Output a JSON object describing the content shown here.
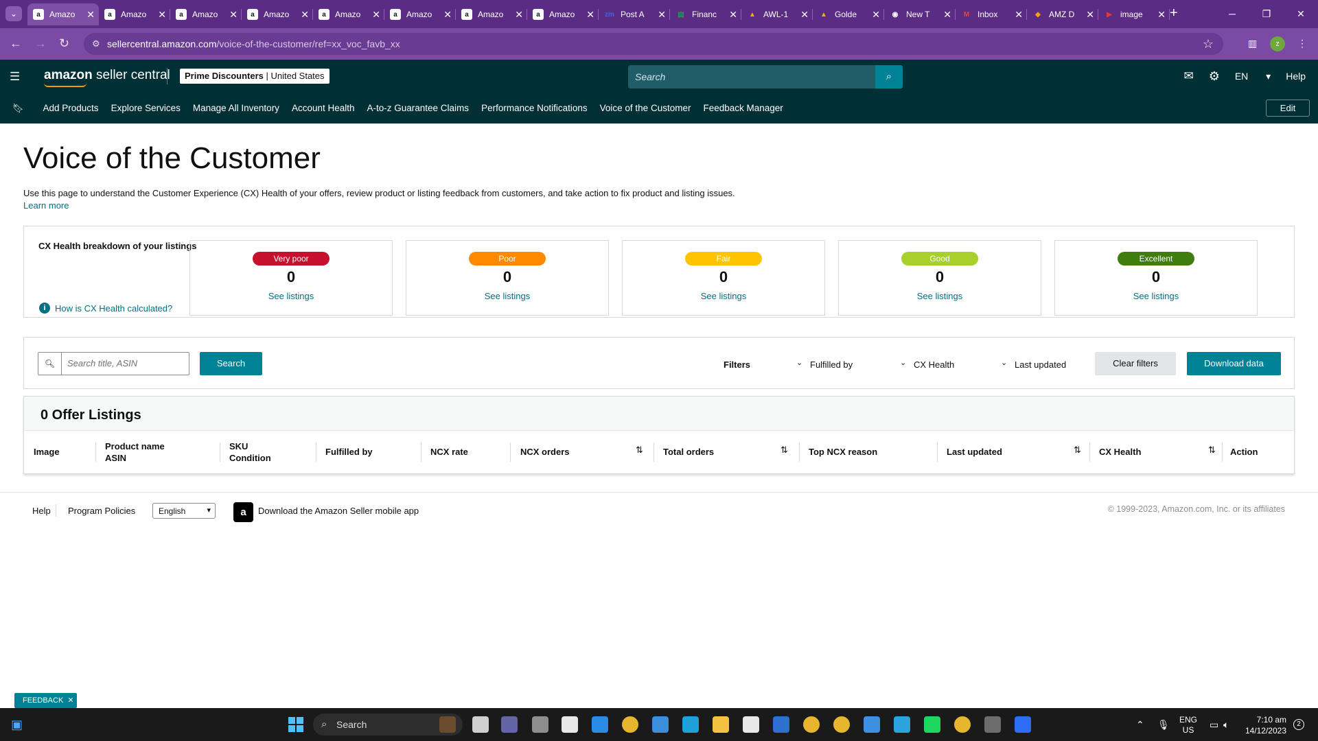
{
  "browser": {
    "tabs": [
      {
        "title": "Amazo",
        "icon": "amazon-icon",
        "color": "#111111",
        "active": true
      },
      {
        "title": "Amazo",
        "icon": "amazon-icon",
        "color": "#111111"
      },
      {
        "title": "Amazo",
        "icon": "amazon-icon",
        "color": "#111111"
      },
      {
        "title": "Amazo",
        "icon": "amazon-icon",
        "color": "#111111"
      },
      {
        "title": "Amazo",
        "icon": "amazon-icon",
        "color": "#111111"
      },
      {
        "title": "Amazo",
        "icon": "amazon-icon",
        "color": "#111111"
      },
      {
        "title": "Amazo",
        "icon": "amazon-icon",
        "color": "#111111"
      },
      {
        "title": "Amazo",
        "icon": "amazon-icon",
        "color": "#111111"
      },
      {
        "title": "Post A",
        "icon": "zoom-icon",
        "color": "#2d6cf4"
      },
      {
        "title": "Financ",
        "icon": "sheets-icon",
        "color": "#1e9a4d"
      },
      {
        "title": "AWL-1",
        "icon": "drive-icon",
        "color": "#f4b400"
      },
      {
        "title": "Golde",
        "icon": "drive-icon",
        "color": "#f4b400"
      },
      {
        "title": "New T",
        "icon": "chrome-icon",
        "color": "#ffffff"
      },
      {
        "title": "Inbox",
        "icon": "gmail-icon",
        "color": "#ea4335"
      },
      {
        "title": "AMZ D",
        "icon": "slides-icon",
        "color": "#f4a300"
      },
      {
        "title": "image",
        "icon": "youtube-icon",
        "color": "#e53935"
      }
    ],
    "url_host": "sellercentral.amazon.com",
    "url_path": "/voice-of-the-customer/ref=xx_voc_favb_xx",
    "profile_initial": "z"
  },
  "header": {
    "logo_main": "amazon",
    "logo_sub": " seller central",
    "account_name": "Prime Discounters",
    "account_region": " | United States",
    "search_placeholder": "Search",
    "language": "EN",
    "help": "Help"
  },
  "nav": {
    "items": [
      "Add Products",
      "Explore Services",
      "Manage All Inventory",
      "Account Health",
      "A-to-z Guarantee Claims",
      "Performance Notifications",
      "Voice of the Customer",
      "Feedback Manager"
    ],
    "edit": "Edit"
  },
  "page": {
    "title": "Voice of the Customer",
    "description": "Use this page to understand the Customer Experience (CX) Health of your offers, review product or listing feedback from customers, and take action to fix product and listing issues.",
    "learn_more": "Learn more"
  },
  "cx_health": {
    "label": "CX Health breakdown of your listings",
    "how_link": "How is CX Health calculated?",
    "see_listings": "See listings",
    "cards": [
      {
        "label": "Very poor",
        "count": "0",
        "color": "#c7102e"
      },
      {
        "label": "Poor",
        "count": "0",
        "color": "#ff8a00"
      },
      {
        "label": "Fair",
        "count": "0",
        "color": "#ffc400"
      },
      {
        "label": "Good",
        "count": "0",
        "color": "#a7d02d"
      },
      {
        "label": "Excellent",
        "count": "0",
        "color": "#3f7d0e"
      }
    ]
  },
  "filters": {
    "search_placeholder": "Search title, ASIN",
    "search_button": "Search",
    "filters_label": "Filters",
    "fulfilled_by": "Fulfilled by",
    "cx_health": "CX Health",
    "last_updated": "Last updated",
    "clear": "Clear filters",
    "download": "Download data"
  },
  "listings": {
    "heading": "0 Offer Listings",
    "columns": [
      {
        "line1": "Image",
        "line2": ""
      },
      {
        "line1": "Product name",
        "line2": "ASIN"
      },
      {
        "line1": "SKU",
        "line2": "Condition"
      },
      {
        "line1": "Fulfilled by",
        "line2": ""
      },
      {
        "line1": "NCX rate",
        "line2": ""
      },
      {
        "line1": "NCX orders",
        "line2": ""
      },
      {
        "line1": "Total orders",
        "line2": ""
      },
      {
        "line1": "Top NCX reason",
        "line2": ""
      },
      {
        "line1": "Last updated",
        "line2": ""
      },
      {
        "line1": "CX Health",
        "line2": ""
      },
      {
        "line1": "Action",
        "line2": ""
      }
    ]
  },
  "footer": {
    "help": "Help",
    "policies": "Program Policies",
    "language": "English",
    "app": "Download the Amazon Seller mobile app",
    "copyright": "© 1999-2023, Amazon.com, Inc. or its affiliates"
  },
  "feedback": "FEEDBACK",
  "taskbar": {
    "search": "Search",
    "lang1": "ENG",
    "lang2": "US",
    "time": "7:10 am",
    "date": "14/12/2023",
    "notif": "2"
  }
}
